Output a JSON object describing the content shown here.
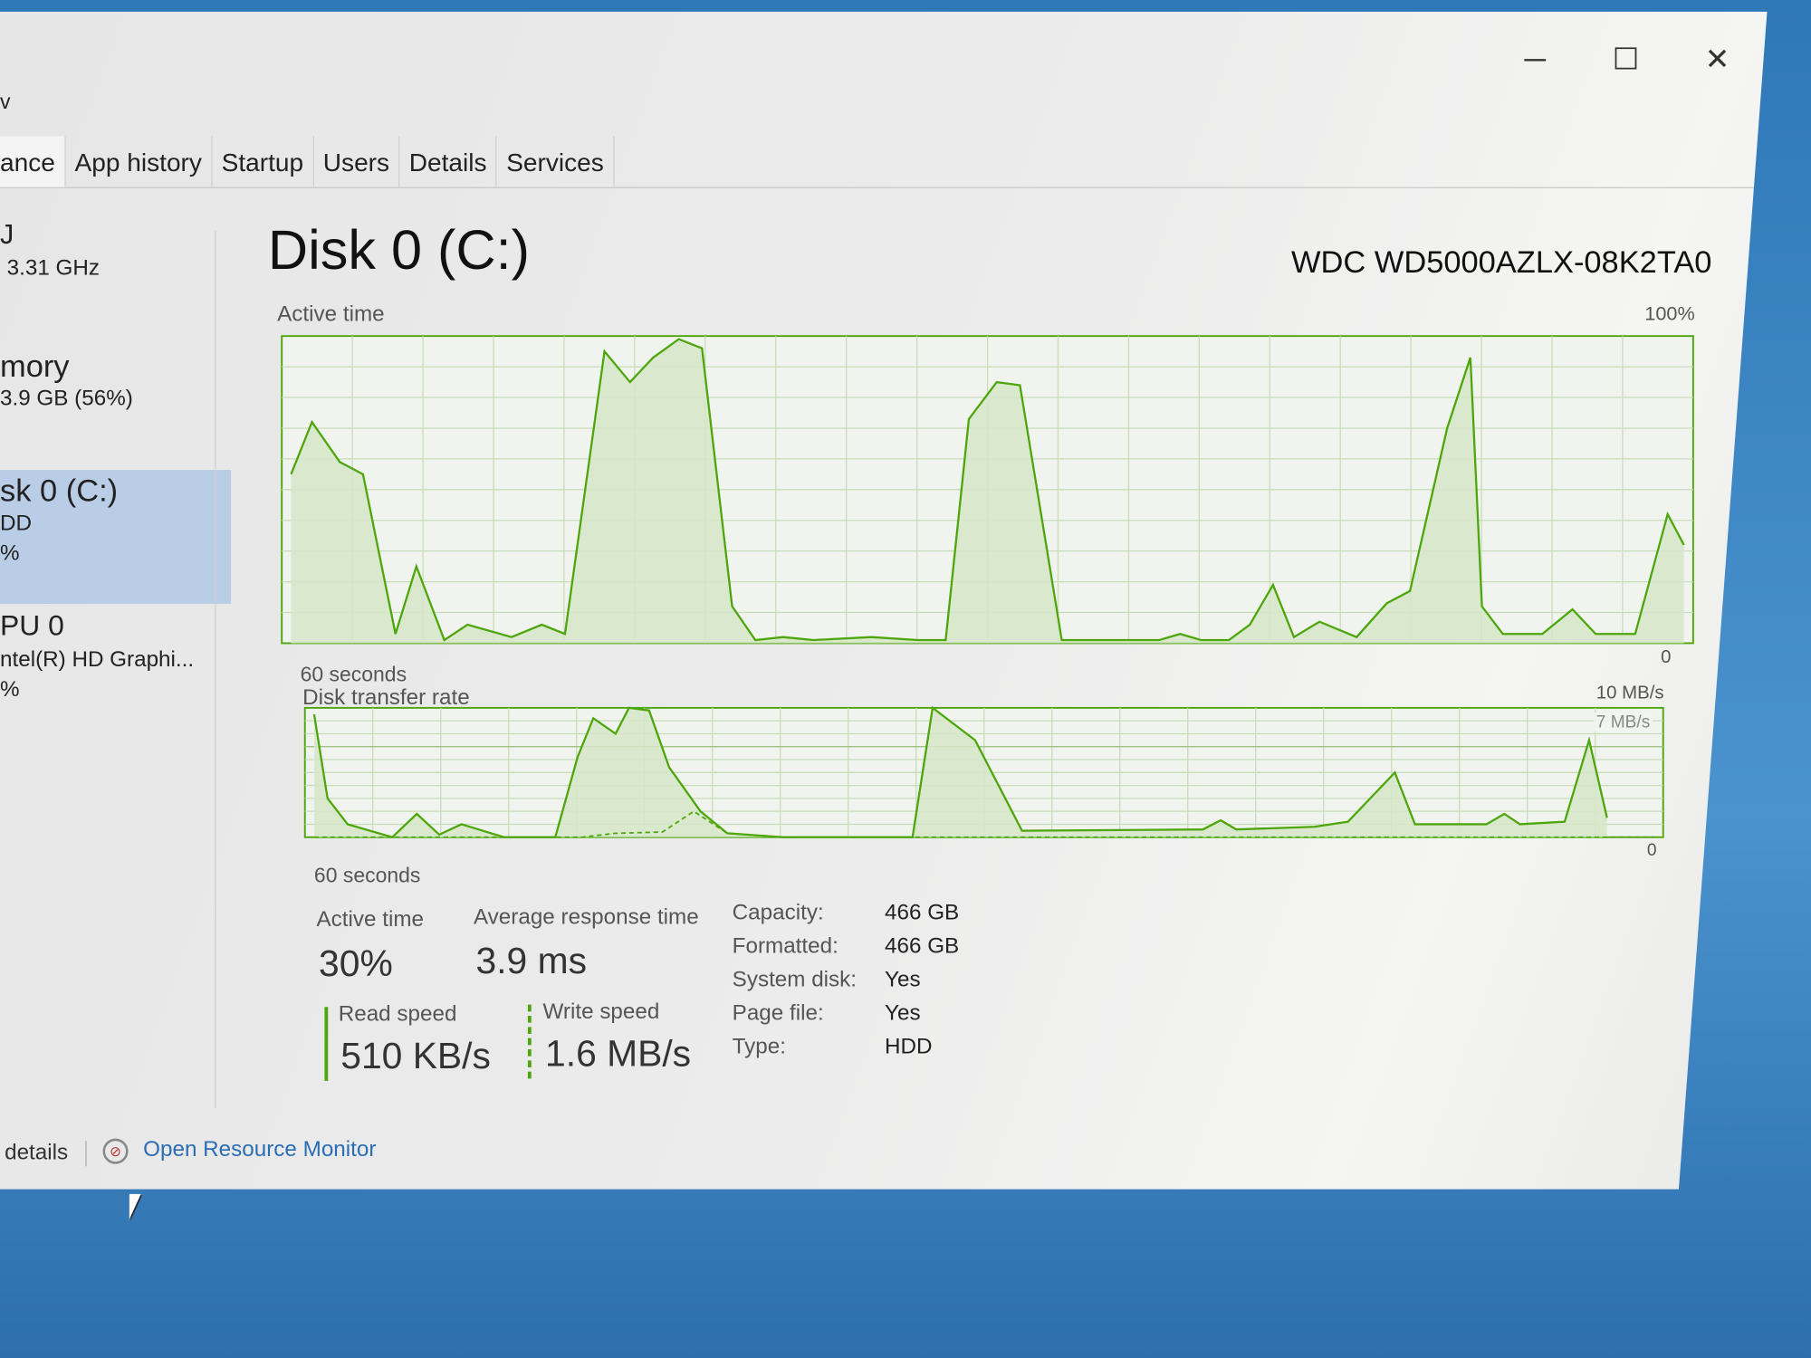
{
  "window_controls": {
    "minimize": "─",
    "maximize": "☐",
    "close": "✕"
  },
  "menu_fragment": "v",
  "tabs": [
    {
      "label": "ance"
    },
    {
      "label": "App history"
    },
    {
      "label": "Startup"
    },
    {
      "label": "Users"
    },
    {
      "label": "Details"
    },
    {
      "label": "Services"
    }
  ],
  "sidebar": {
    "items": [
      {
        "title": "J",
        "sub": "3.31 GHz",
        "pct": ""
      },
      {
        "title": "mory",
        "sub": "3.9 GB (56%)",
        "pct": ""
      },
      {
        "title": "sk 0 (C:)",
        "sub": "DD",
        "pct": "%",
        "selected": true
      },
      {
        "title": "PU 0",
        "sub": "ntel(R) HD Graphi...",
        "pct": "%"
      }
    ]
  },
  "main": {
    "title": "Disk 0 (C:)",
    "model": "WDC WD5000AZLX-08K2TA0",
    "active_chart": {
      "label": "Active time",
      "max_label": "100%",
      "min_label": "0",
      "time_label": "60 seconds"
    },
    "transfer_chart": {
      "label": "Disk transfer rate",
      "max_label": "10 MB/s",
      "ref_label": "7 MB/s",
      "min_label": "0",
      "time_label": "60 seconds"
    },
    "stats": {
      "active_time_label": "Active time",
      "active_time": "30%",
      "avg_resp_label": "Average response time",
      "avg_resp": "3.9 ms",
      "read_label": "Read speed",
      "read": "510 KB/s",
      "write_label": "Write speed",
      "write": "1.6 MB/s"
    },
    "properties": [
      {
        "k": "Capacity:",
        "v": "466 GB"
      },
      {
        "k": "Formatted:",
        "v": "466 GB"
      },
      {
        "k": "System disk:",
        "v": "Yes"
      },
      {
        "k": "Page file:",
        "v": "Yes"
      },
      {
        "k": "Type:",
        "v": "HDD"
      }
    ]
  },
  "footer": {
    "details": "details",
    "resource_monitor": "Open Resource Monitor"
  },
  "colors": {
    "accent": "#4da60c",
    "fill": "#d6e6c8",
    "grid": "#c7dcb8",
    "selected": "#b9cde6",
    "link": "#2a6db5"
  },
  "chart_data": [
    {
      "type": "area",
      "title": "Active time",
      "xlabel": "60 seconds",
      "xlim": [
        60,
        0
      ],
      "ylim": [
        0,
        100
      ],
      "grid": true,
      "series": [
        {
          "points": [
            [
              60,
              55
            ],
            [
              59.1,
              72
            ],
            [
              57.9,
              59
            ],
            [
              56.9,
              55
            ],
            [
              55.5,
              3
            ],
            [
              54.6,
              25
            ],
            [
              53.4,
              1
            ],
            [
              52.4,
              6
            ],
            [
              50.5,
              2
            ],
            [
              49.2,
              6
            ],
            [
              48.2,
              3
            ],
            [
              46.5,
              95
            ],
            [
              45.4,
              85
            ],
            [
              44.4,
              93
            ],
            [
              43.3,
              99
            ],
            [
              42.3,
              96
            ],
            [
              41,
              12
            ],
            [
              40,
              1
            ],
            [
              38.8,
              2
            ],
            [
              37.5,
              1
            ],
            [
              35,
              2
            ],
            [
              33,
              1
            ],
            [
              31.8,
              1
            ],
            [
              30.8,
              73
            ],
            [
              29.6,
              85
            ],
            [
              28.6,
              84
            ],
            [
              26.8,
              1
            ],
            [
              22.6,
              1
            ],
            [
              21.7,
              3
            ],
            [
              20.8,
              1
            ],
            [
              19.6,
              1
            ],
            [
              18.7,
              6
            ],
            [
              17.7,
              19
            ],
            [
              16.8,
              2
            ],
            [
              15.7,
              7
            ],
            [
              14.1,
              2
            ],
            [
              12.8,
              13
            ],
            [
              11.8,
              17
            ],
            [
              10.2,
              70
            ],
            [
              9.2,
              93
            ],
            [
              8.7,
              12
            ],
            [
              7.8,
              3
            ],
            [
              6.1,
              3
            ],
            [
              4.8,
              11
            ],
            [
              3.8,
              3
            ],
            [
              2.1,
              3
            ],
            [
              0.7,
              42
            ],
            [
              0,
              32
            ]
          ]
        }
      ]
    },
    {
      "type": "area",
      "title": "Disk transfer rate",
      "xlabel": "60 seconds",
      "xlim": [
        60,
        0
      ],
      "ylim": [
        0,
        10
      ],
      "reference_line": 7,
      "grid": true,
      "series": [
        {
          "name": "Read speed",
          "points": [
            [
              60,
              9.5
            ],
            [
              59.4,
              3
            ],
            [
              58.5,
              1
            ],
            [
              56.5,
              0
            ],
            [
              55.4,
              1.8
            ],
            [
              54.4,
              0.2
            ],
            [
              53.4,
              1
            ],
            [
              51.5,
              0
            ],
            [
              49.2,
              0
            ],
            [
              48.2,
              6.2
            ],
            [
              47.5,
              9.2
            ],
            [
              46.5,
              8
            ],
            [
              45.9,
              10
            ],
            [
              45,
              9.8
            ],
            [
              44.1,
              5.4
            ],
            [
              42.7,
              2
            ],
            [
              41.5,
              0.3
            ],
            [
              39,
              0
            ],
            [
              33.2,
              0
            ],
            [
              32.3,
              10
            ],
            [
              30.4,
              7.5
            ],
            [
              28.3,
              0.5
            ],
            [
              20.2,
              0.6
            ],
            [
              19.4,
              1.3
            ],
            [
              18.7,
              0.6
            ],
            [
              15.2,
              0.8
            ],
            [
              13.7,
              1.2
            ],
            [
              11.6,
              5
            ],
            [
              10.7,
              1
            ],
            [
              7.5,
              1
            ],
            [
              6.7,
              1.8
            ],
            [
              6,
              1
            ],
            [
              4,
              1.2
            ],
            [
              2.9,
              7.5
            ],
            [
              2.1,
              1.5
            ]
          ]
        },
        {
          "name": "Write speed",
          "points": [
            [
              60,
              0
            ],
            [
              48,
              0
            ],
            [
              46.5,
              0.3
            ],
            [
              44.4,
              0.4
            ],
            [
              43,
              2
            ],
            [
              41.5,
              0.3
            ],
            [
              39,
              0
            ],
            [
              0,
              0
            ]
          ]
        }
      ]
    }
  ]
}
